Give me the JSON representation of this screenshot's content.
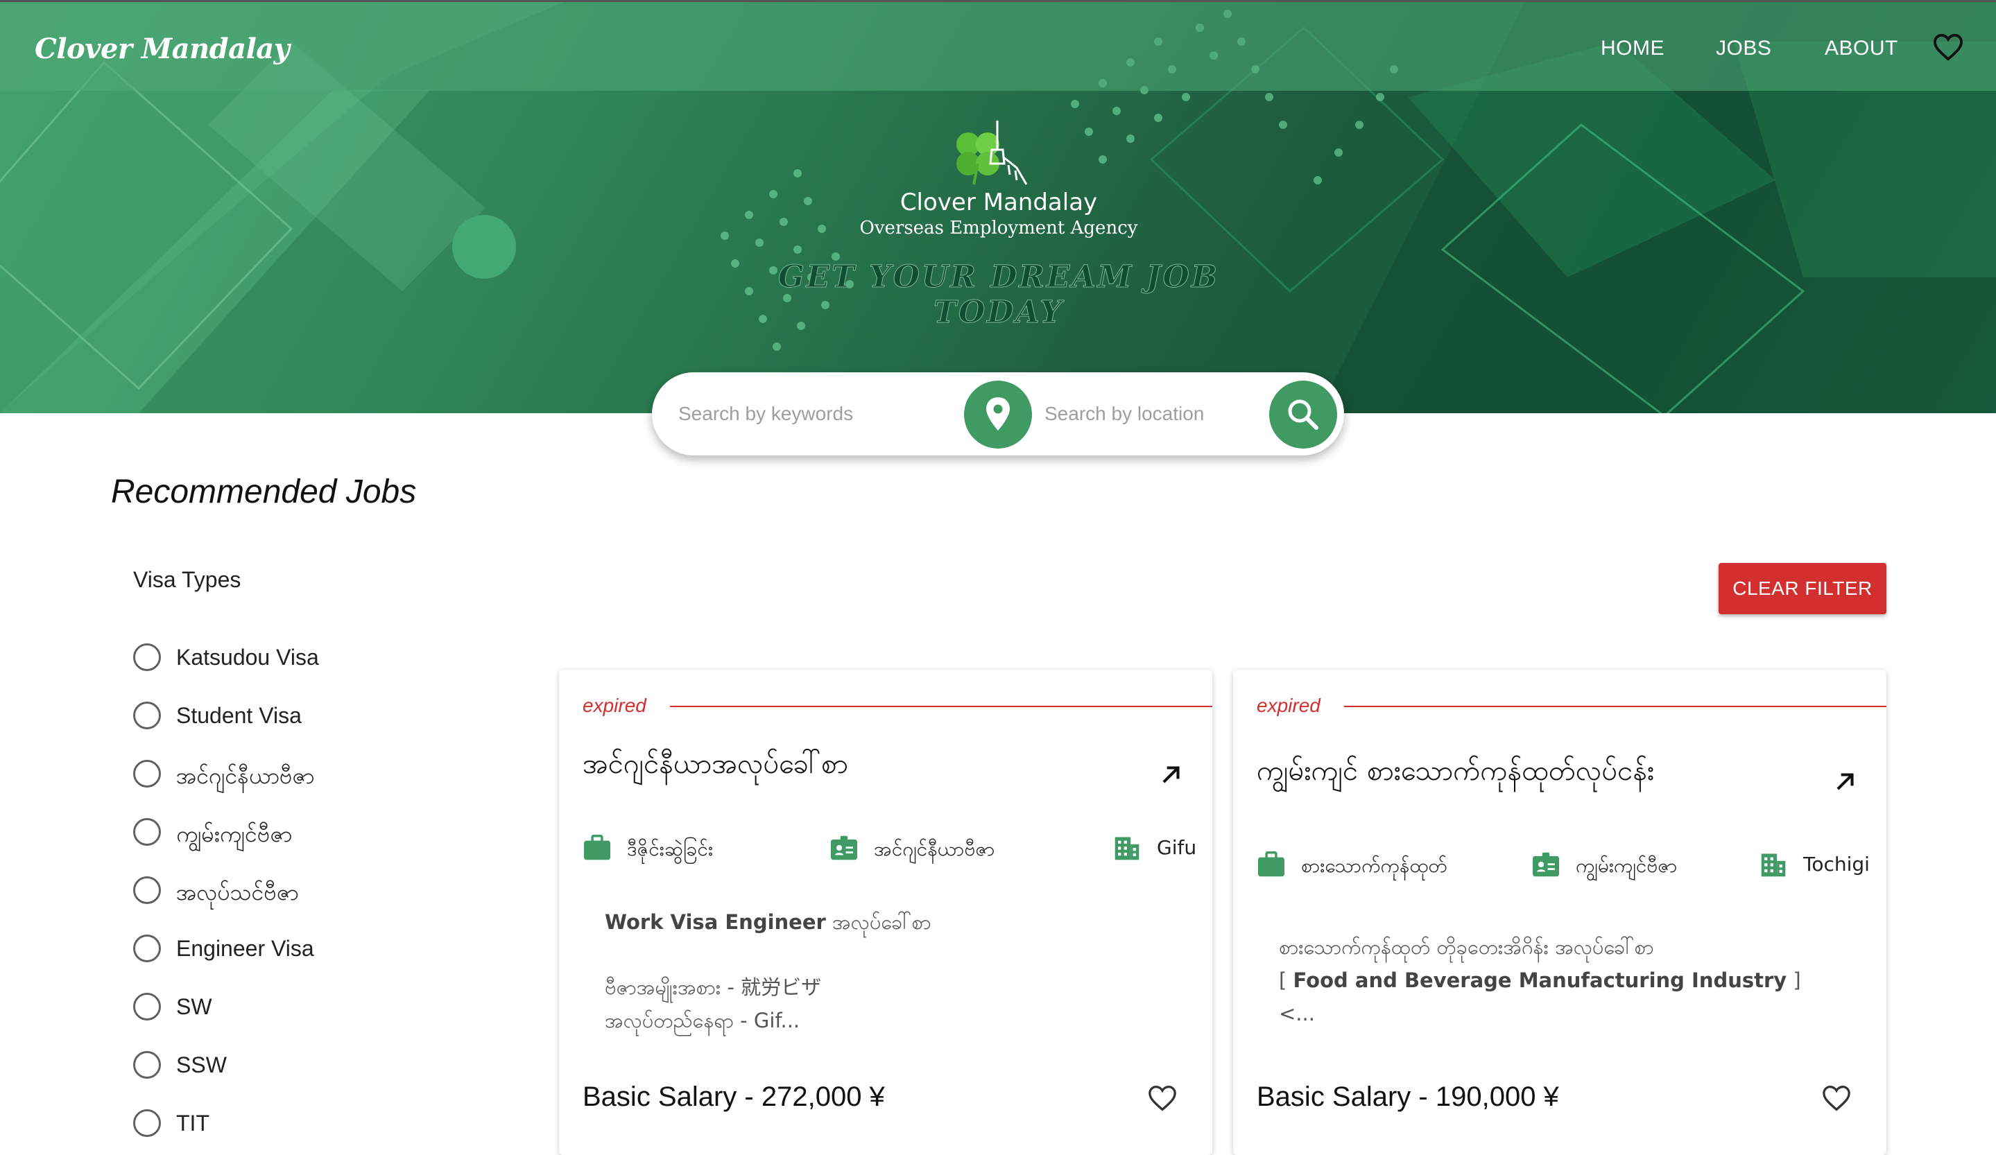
{
  "navbar": {
    "brand": "Clover Mandalay",
    "links": [
      "HOME",
      "JOBS",
      "ABOUT"
    ],
    "favorites_icon": "heart-outline-icon"
  },
  "hero": {
    "logo_title": "Clover Mandalay",
    "logo_subtitle": "Overseas Employment Agency",
    "tagline": "GET YOUR DREAM JOB TODAY",
    "colors": {
      "primary_green": "#3f9a63",
      "dark_green": "#15563a"
    }
  },
  "search": {
    "keywords_placeholder": "Search by keywords",
    "location_placeholder": "Search by location",
    "location_icon": "map-pin-icon",
    "submit_icon": "search-icon"
  },
  "main": {
    "section_title": "Recommended Jobs",
    "filter_title": "Visa Types",
    "visa_types": [
      "Katsudou Visa",
      "Student Visa",
      "အင်ဂျင်နီယာဗီဇာ",
      "ကျွမ်းကျင်ဗီဇာ",
      "အလုပ်သင်ဗီဇာ",
      "Engineer Visa",
      "SW",
      "SSW",
      "TIT"
    ],
    "clear_filter_label": "CLEAR FILTER",
    "accent_red": "#d32f2f"
  },
  "jobs": [
    {
      "status": "expired",
      "title": "အင်ဂျင်နီယာအလုပ်ခေါ်စာ",
      "category": "ဒီဇိုင်းဆွဲခြင်း",
      "visa": "အင်ဂျင်နီယာဗီဇာ",
      "location": "Gifu",
      "desc_strong": "Work Visa Engineer",
      "desc_after": " အလုပ်ခေါ်စာ",
      "desc_line2": "ဗီဇာအမျိုးအစား - 就労ビザ",
      "desc_line3": "အလုပ်တည်နေရာ - Gif...",
      "salary": "Basic Salary - 272,000 ¥"
    },
    {
      "status": "expired",
      "title": "ကျွမ်းကျင် စားသောက်ကုန်ထုတ်လုပ်ငန်း",
      "category": "စားသောက်ကုန်ထုတ်",
      "visa": "ကျွမ်းကျင်ဗီဇာ",
      "location": "Tochigi",
      "desc_line1": "စားသောက်ကုန်ထုတ် တိုခုတေးအိဂိန်း အလုပ်ခေါ်စာ",
      "desc_bracket_open": "[ ",
      "desc_strong": "Food and Beverage Manufacturing Industry",
      "desc_bracket_close": " ]",
      "desc_line3": "<...",
      "salary": "Basic Salary - 190,000 ¥"
    }
  ]
}
